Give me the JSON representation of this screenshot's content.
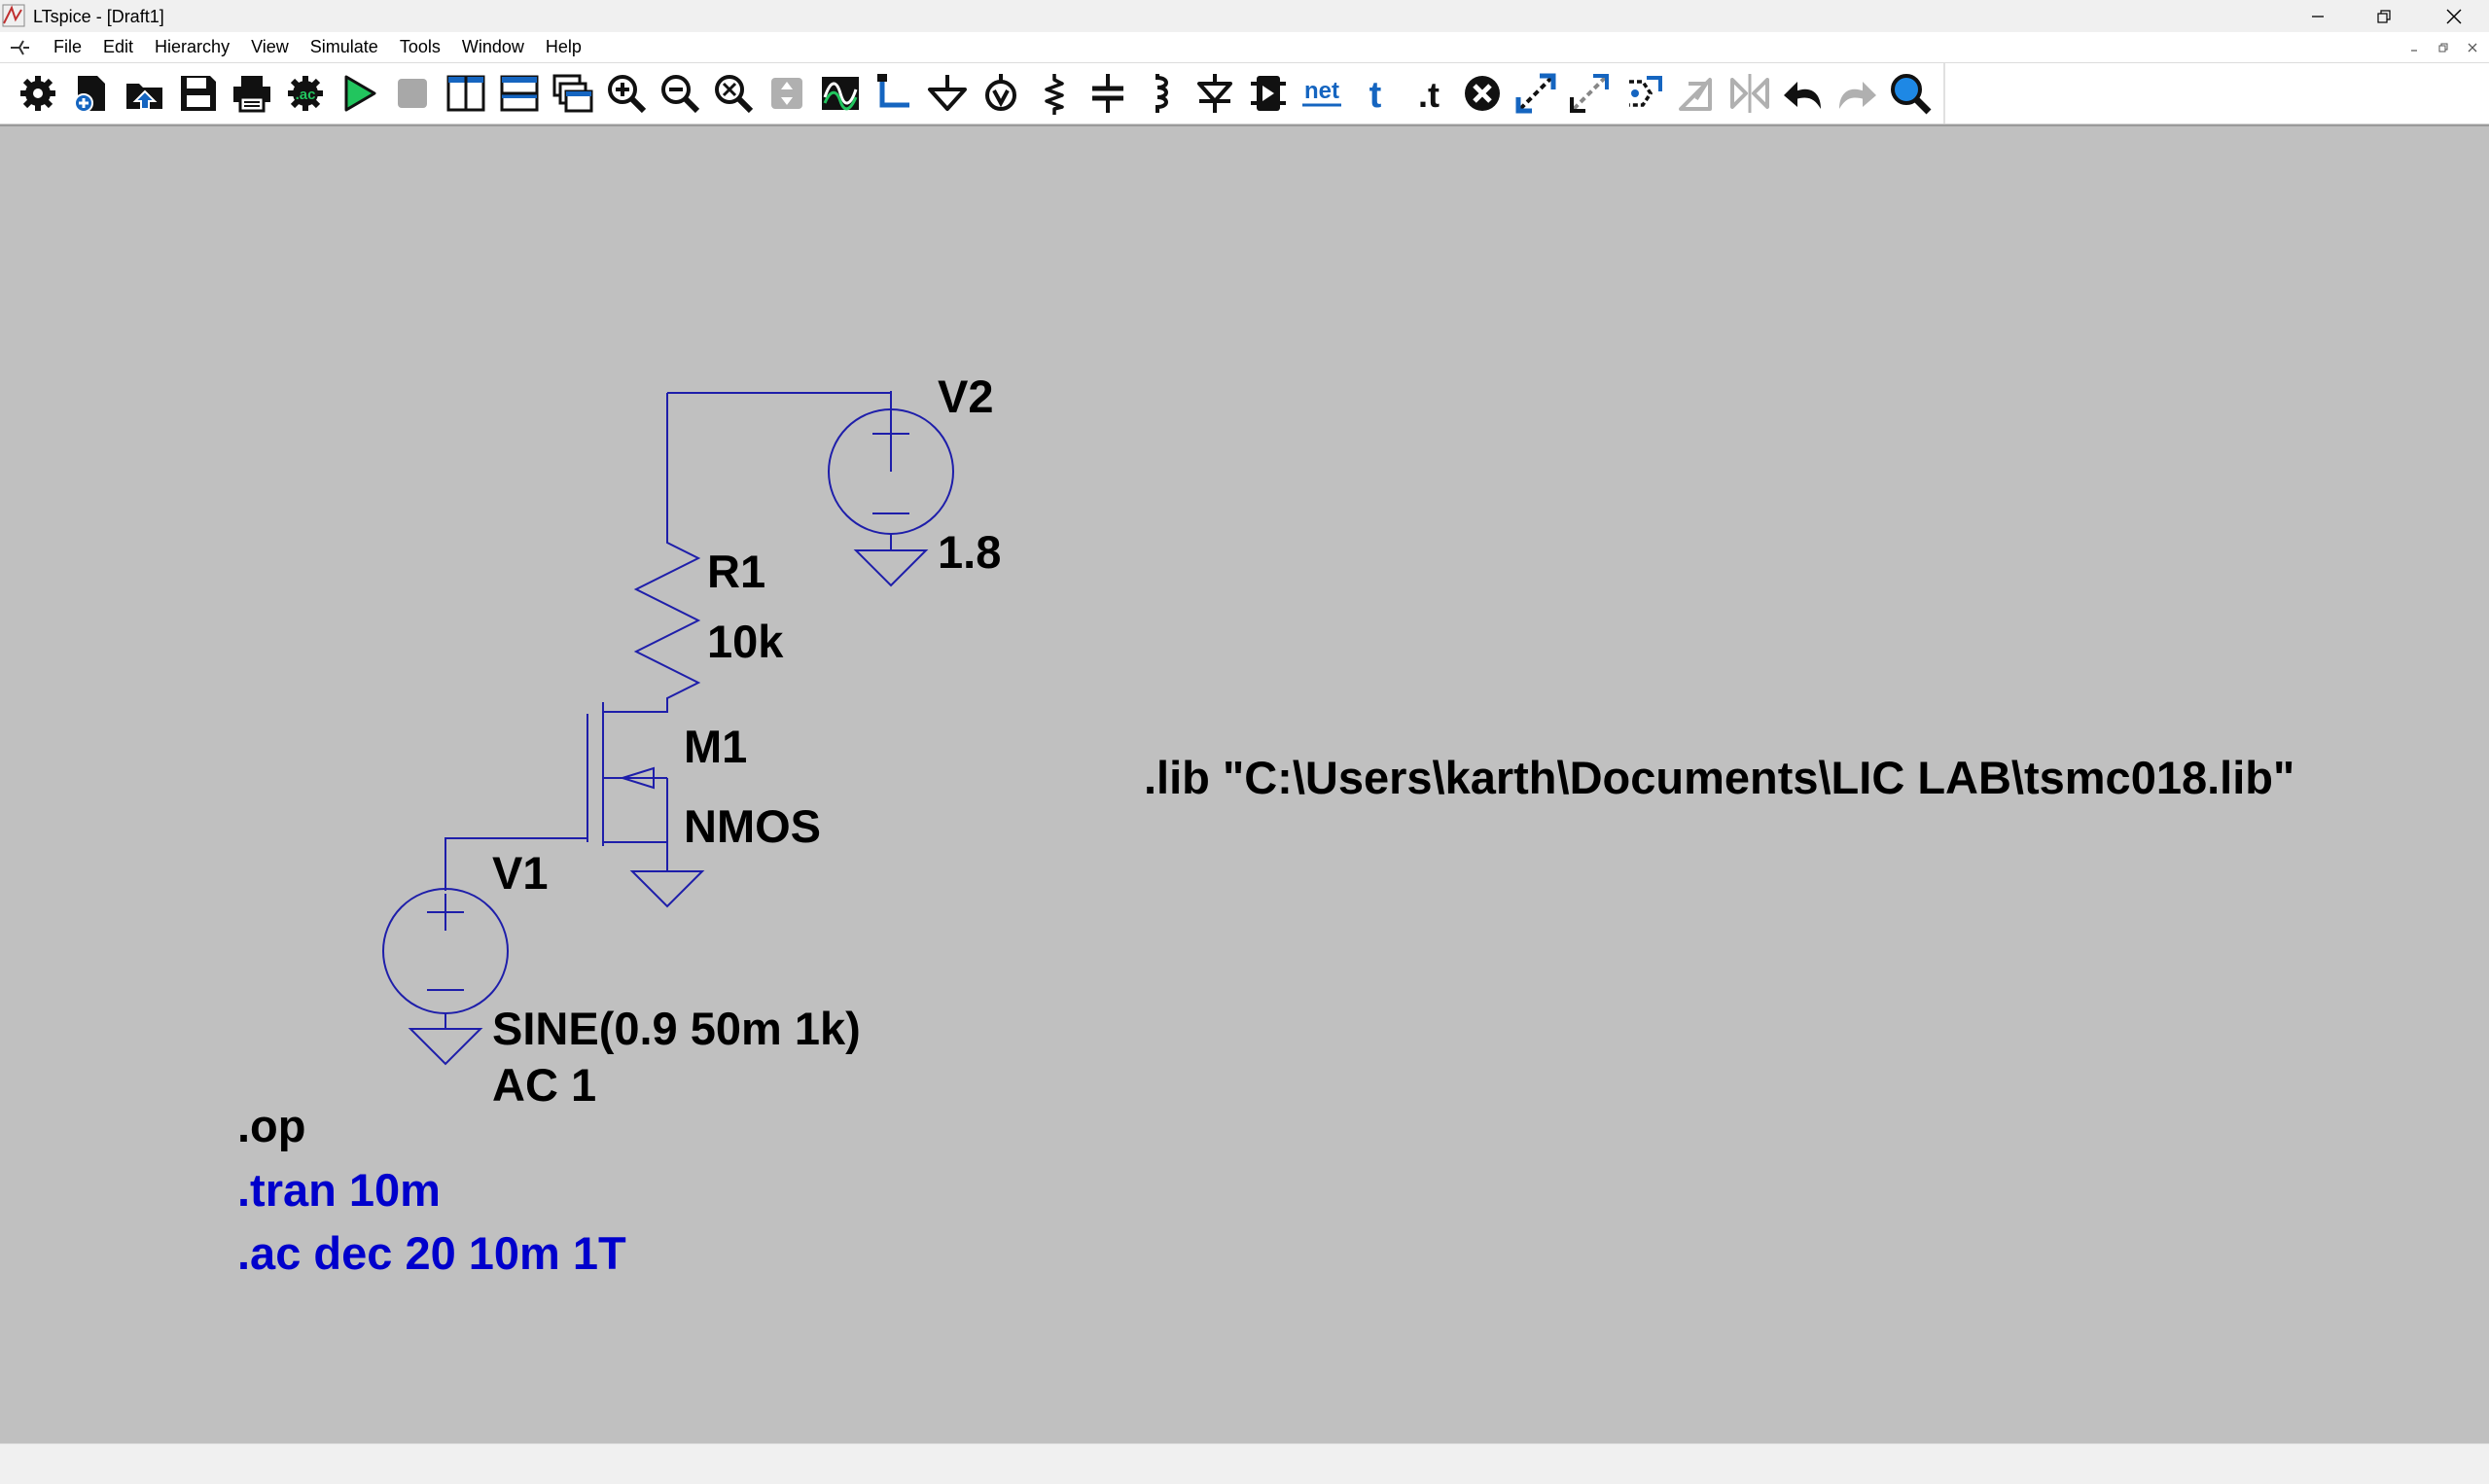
{
  "window": {
    "title": "LTspice - [Draft1]"
  },
  "menu": {
    "items": [
      "File",
      "Edit",
      "Hierarchy",
      "View",
      "Simulate",
      "Tools",
      "Window",
      "Help"
    ]
  },
  "toolbar": {
    "buttons": [
      "settings-icon",
      "new-schematic-icon",
      "open-icon",
      "save-icon",
      "print-icon",
      "edit-simulation-cmd-icon",
      "run-icon",
      "halt-icon",
      "tile-vertical-icon",
      "tile-horizontal-icon",
      "cascade-icon",
      "zoom-in-icon",
      "zoom-out-icon",
      "zoom-fit-icon",
      "pan-icon",
      "waveform-icon",
      "draw-wire-icon",
      "ground-icon",
      "voltage-source-icon",
      "resistor-icon",
      "capacitor-icon",
      "inductor-icon",
      "diode-icon",
      "component-icon",
      "net-label-icon",
      "text-icon",
      "spice-directive-icon",
      "delete-icon",
      "duplicate-icon",
      "move-icon",
      "drag-icon",
      "rotate-icon",
      "mirror-icon",
      "undo-icon",
      "redo-icon",
      "find-icon"
    ],
    "net_label": "net",
    "text_glyph": "t",
    "spice_glyph": ".t"
  },
  "schematic": {
    "v2": {
      "name": "V2",
      "value": "1.8"
    },
    "r1": {
      "name": "R1",
      "value": "10k"
    },
    "m1": {
      "name": "M1",
      "model": "NMOS"
    },
    "v1": {
      "name": "V1",
      "value_line1": "SINE(0.9 50m 1k)",
      "value_line2": "AC 1"
    },
    "directives": {
      "op": ".op",
      "tran": ".tran 10m",
      "ac": ".ac dec 20 10m 1T",
      "lib": ".lib \"C:\\Users\\karth\\Documents\\LIC LAB\\tsmc018.lib\""
    }
  },
  "colors": {
    "wire": "#1e1eaa",
    "canvas": "#c0c0c0",
    "active_directive": "#0000cc"
  }
}
